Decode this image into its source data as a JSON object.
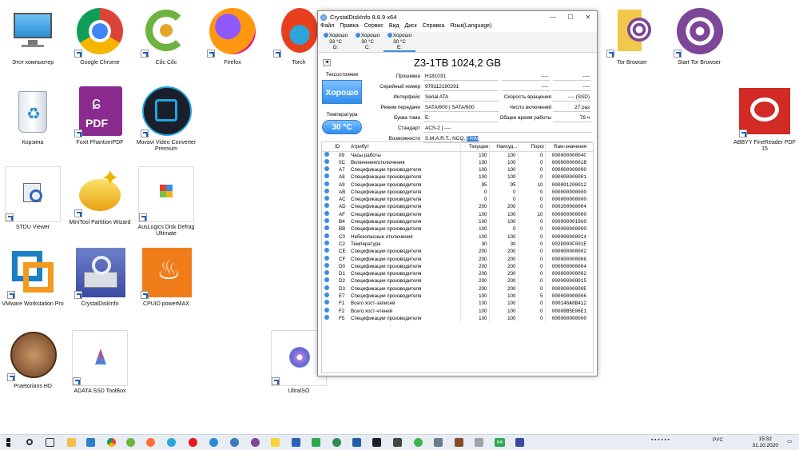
{
  "desktop": {
    "icons": [
      {
        "label": "Этот компьютер"
      },
      {
        "label": "Google Chrome"
      },
      {
        "label": "Cốc Cốc"
      },
      {
        "label": "Firefox"
      },
      {
        "label": "Torch"
      },
      {
        "label": "Tor Browser"
      },
      {
        "label": "Start Tor Browser"
      },
      {
        "label": "Корзина"
      },
      {
        "label": "Foxit PhantomPDF"
      },
      {
        "label": "Movavi Video Converter Premium"
      },
      {
        "label": "ABBYY FineReader PDF 15"
      },
      {
        "label": "STDU Viewer"
      },
      {
        "label": "MiniTool Partition Wizard"
      },
      {
        "label": "AusLogics Disk Defrag Ultimate"
      },
      {
        "label": "VMware Workstation Pro"
      },
      {
        "label": "CrystalDiskInfo"
      },
      {
        "label": "CPUID powerMAX"
      },
      {
        "label": "Praetorians HD"
      },
      {
        "label": "ADATA SSD ToolBox"
      },
      {
        "label": "UltraISO"
      }
    ]
  },
  "window": {
    "title": "CrystalDiskInfo 8.8.9 x64",
    "controls": {
      "minimize": "—",
      "maximize": "☐",
      "close": "✕"
    },
    "menu": [
      "Файл",
      "Правка",
      "Сервис",
      "Вид",
      "Диск",
      "Справка",
      "Язык(Language)"
    ],
    "drives": [
      {
        "status": "Хорошо",
        "temp": "33 °C",
        "letter": "D:"
      },
      {
        "status": "Хорошо",
        "temp": "30 °C",
        "letter": "C:"
      },
      {
        "status": "Хорошо",
        "temp": "30 °C",
        "letter": "E:"
      }
    ],
    "model": "Z3-1TB 1024,2 GB",
    "nav_prev": "◄",
    "health_label": "Техсостояние",
    "health_value": "Хорошо",
    "temp_label": "Температура",
    "temp_value": "30 °C",
    "fields": {
      "firmware_label": "Прошивка",
      "firmware": "H181031",
      "serial_label": "Серийный номер",
      "serial": "979112190291",
      "interface_label": "Интерфейс",
      "interface": "Serial ATA",
      "transfer_label": "Режим передачи",
      "transfer": "SATA/600 | SATA/600",
      "letter_label": "Буква тома",
      "letter": "E:",
      "standard_label": "Стандарт",
      "standard": "ACS-2 | ----",
      "features_label": "Возможности",
      "features": "S.M.A.R.T., NCQ, ",
      "features_hl": "TRIM",
      "blank1a": "----",
      "blank1b": "----",
      "blank2a": "----",
      "blank2b": "----",
      "rotation_label": "Скорость вращения",
      "rotation": "---- (SSD)",
      "power_count_label": "Число включений",
      "power_count": "27 раз",
      "power_hours_label": "Общее время работы",
      "power_hours": "76 ч"
    },
    "table": {
      "headers": [
        "ID",
        "Атрибут",
        "Текущее",
        "Наихуд...",
        "Порог",
        "Raw-значения"
      ],
      "rows": [
        [
          "09",
          "Часы работы",
          "100",
          "100",
          "0",
          "00000000004C"
        ],
        [
          "0C",
          "Включения/отключения",
          "100",
          "100",
          "0",
          "00000000001B"
        ],
        [
          "A7",
          "Спецификации производителя",
          "100",
          "100",
          "0",
          "000000000000"
        ],
        [
          "A8",
          "Спецификации производителя",
          "100",
          "100",
          "0",
          "000000000001"
        ],
        [
          "A9",
          "Спецификации производителя",
          "95",
          "95",
          "10",
          "000001200012"
        ],
        [
          "AB",
          "Спецификации производителя",
          "0",
          "0",
          "0",
          "000000000000"
        ],
        [
          "AC",
          "Спецификации производителя",
          "0",
          "0",
          "0",
          "000000000000"
        ],
        [
          "AD",
          "Спецификации производителя",
          "200",
          "200",
          "0",
          "000200060004"
        ],
        [
          "AF",
          "Спецификации производителя",
          "100",
          "100",
          "10",
          "000000000000"
        ],
        [
          "B4",
          "Спецификации производителя",
          "100",
          "100",
          "0",
          "000000001960"
        ],
        [
          "BB",
          "Спецификации производителя",
          "100",
          "0",
          "0",
          "000000000000"
        ],
        [
          "C0",
          "Небезопасные отключения",
          "100",
          "100",
          "0",
          "000000000014"
        ],
        [
          "C2",
          "Температура",
          "30",
          "30",
          "0",
          "002D000F001E"
        ],
        [
          "CE",
          "Спецификации производителя",
          "200",
          "200",
          "0",
          "000000000002"
        ],
        [
          "CF",
          "Спецификации производителя",
          "200",
          "200",
          "0",
          "000000000006"
        ],
        [
          "D0",
          "Спецификации производителя",
          "200",
          "200",
          "0",
          "000000000004"
        ],
        [
          "D1",
          "Спецификации производителя",
          "200",
          "200",
          "0",
          "000000000002"
        ],
        [
          "D2",
          "Спецификации производителя",
          "200",
          "200",
          "0",
          "000000000015"
        ],
        [
          "D3",
          "Спецификации производителя",
          "200",
          "200",
          "0",
          "00000000000E"
        ],
        [
          "E7",
          "Спецификации производителя",
          "100",
          "100",
          "5",
          "000000000006"
        ],
        [
          "F1",
          "Всего хост-записей",
          "100",
          "100",
          "0",
          "000146A8B412"
        ],
        [
          "F2",
          "Всего хост-чтений",
          "100",
          "100",
          "0",
          "00008B5E06E1"
        ],
        [
          "F5",
          "Спецификации производителя",
          "100",
          "100",
          "0",
          "000000000000"
        ]
      ]
    }
  },
  "taskbar": {
    "lang": "РУС",
    "time": "15:32",
    "date": "31.10.2020",
    "badge": "64"
  },
  "colors": {
    "accent": "#3b8be2",
    "good": "#2e8ef0"
  }
}
